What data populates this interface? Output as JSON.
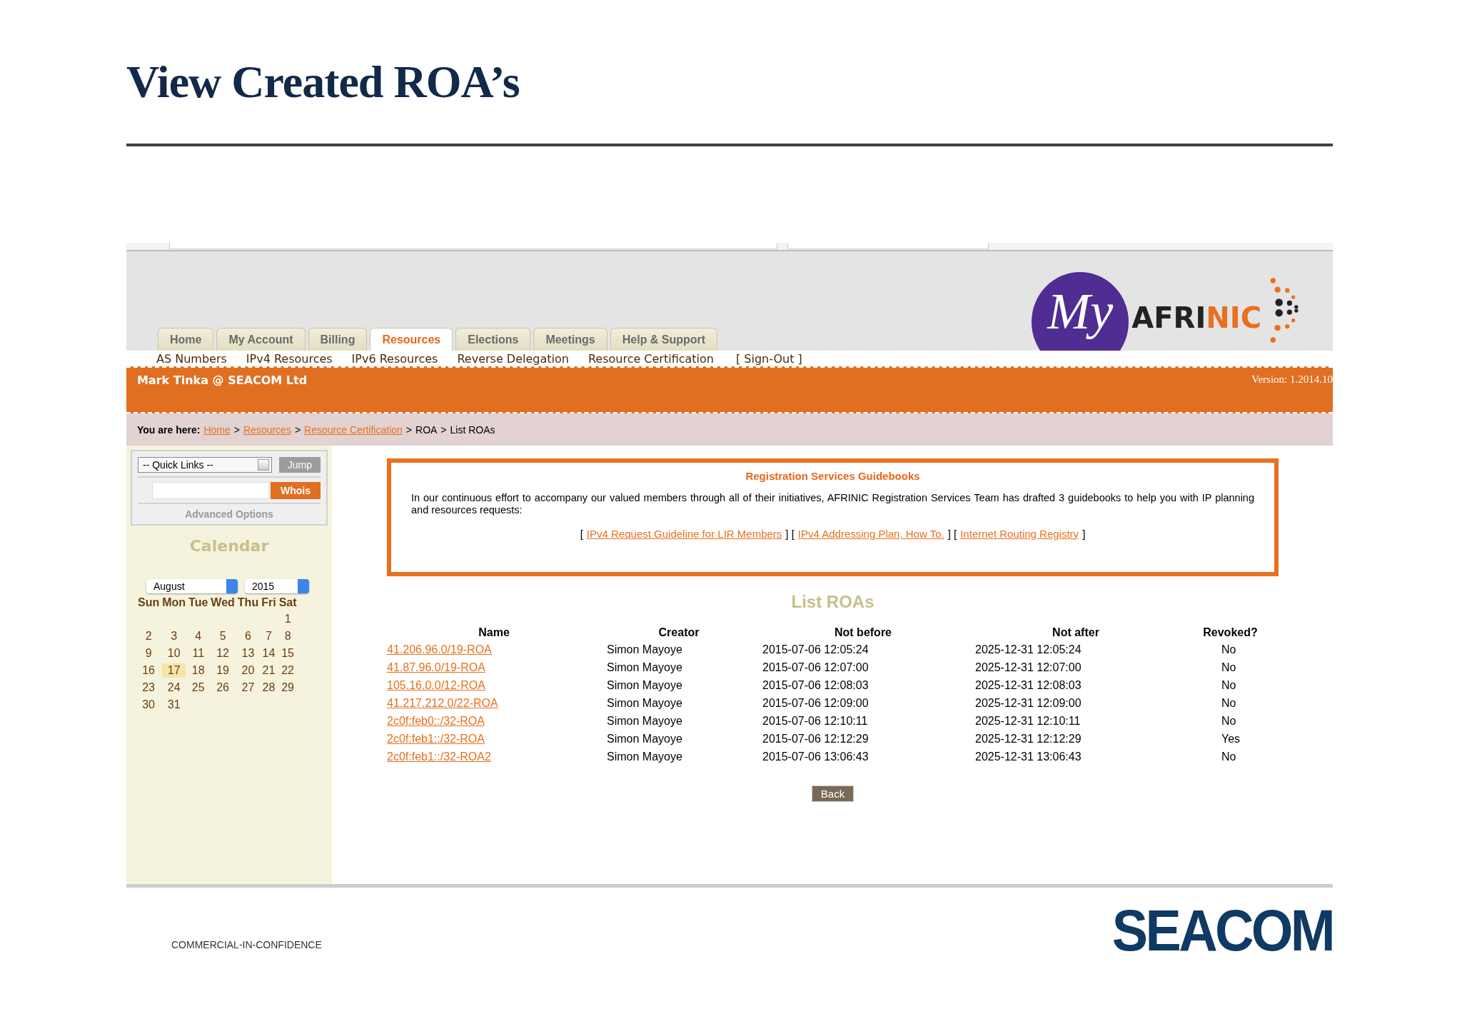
{
  "slide_title": "View Created ROA’s",
  "header": {
    "logo": {
      "script": "My",
      "wordmark_parts": [
        "AFRI",
        "NIC"
      ]
    }
  },
  "tabs": [
    {
      "label": "Home",
      "selected": false
    },
    {
      "label": "My Account",
      "selected": false
    },
    {
      "label": "Billing",
      "selected": false
    },
    {
      "label": "Resources",
      "selected": true
    },
    {
      "label": "Elections",
      "selected": false
    },
    {
      "label": "Meetings",
      "selected": false
    },
    {
      "label": "Help & Support",
      "selected": false
    }
  ],
  "submenu": [
    "AS Numbers",
    "IPv4 Resources",
    "IPv6 Resources",
    "Reverse Delegation",
    "Resource Certification",
    "[ Sign-Out ]"
  ],
  "user_bar": {
    "user": "Mark Tinka @ SEACOM Ltd",
    "version": "Version: 1.2014.10"
  },
  "breadcrumb": {
    "label": "You are here:",
    "items": [
      {
        "kind": "link",
        "text": "Home"
      },
      {
        "kind": "separator",
        "text": ">"
      },
      {
        "kind": "link",
        "text": "Resources"
      },
      {
        "kind": "separator",
        "text": ">"
      },
      {
        "kind": "link",
        "text": "Resource Certification"
      },
      {
        "kind": "separator",
        "text": ">"
      },
      {
        "kind": "text",
        "text": "ROA"
      },
      {
        "kind": "separator",
        "text": ">"
      },
      {
        "kind": "text",
        "text": "List ROAs"
      }
    ]
  },
  "sidebar": {
    "quick_links": {
      "value": "-- Quick Links --",
      "button": "Jump"
    },
    "whois": {
      "button": "Whois"
    },
    "advanced": "Advanced Options",
    "calendar": {
      "title": "Calendar",
      "month": "August",
      "year": "2015",
      "weekdays": [
        "Sun",
        "Mon",
        "Tue",
        "Wed",
        "Thu",
        "Fri",
        "Sat"
      ],
      "weeks": [
        {
          "kind": "partial",
          "days": [
            {
              "label": "1",
              "selected": false
            }
          ]
        },
        {
          "kind": "full",
          "days": [
            {
              "label": "2",
              "selected": false
            },
            {
              "label": "3",
              "selected": false
            },
            {
              "label": "4",
              "selected": false
            },
            {
              "label": "5",
              "selected": false
            },
            {
              "label": "6",
              "selected": false
            },
            {
              "label": "7",
              "selected": false
            },
            {
              "label": "8",
              "selected": false
            }
          ]
        },
        {
          "kind": "full",
          "days": [
            {
              "label": "9",
              "selected": false
            },
            {
              "label": "10",
              "selected": false
            },
            {
              "label": "11",
              "selected": false
            },
            {
              "label": "12",
              "selected": false
            },
            {
              "label": "13",
              "selected": false
            },
            {
              "label": "14",
              "selected": false
            },
            {
              "label": "15",
              "selected": false
            }
          ]
        },
        {
          "kind": "full",
          "days": [
            {
              "label": "16",
              "selected": false
            },
            {
              "label": "17",
              "selected": true
            },
            {
              "label": "18",
              "selected": false
            },
            {
              "label": "19",
              "selected": false
            },
            {
              "label": "20",
              "selected": false
            },
            {
              "label": "21",
              "selected": false
            },
            {
              "label": "22",
              "selected": false
            }
          ]
        },
        {
          "kind": "full",
          "days": [
            {
              "label": "23",
              "selected": false
            },
            {
              "label": "24",
              "selected": false
            },
            {
              "label": "25",
              "selected": false
            },
            {
              "label": "26",
              "selected": false
            },
            {
              "label": "27",
              "selected": false
            },
            {
              "label": "28",
              "selected": false
            },
            {
              "label": "29",
              "selected": false
            }
          ]
        },
        {
          "kind": "full",
          "days": [
            {
              "label": "30",
              "selected": false
            },
            {
              "label": "31",
              "selected": false
            }
          ]
        }
      ]
    }
  },
  "guidebooks": {
    "title": "Registration Services Guidebooks",
    "text": "In our continuous effort to accompany our valued members through all of their initiatives, AFRINIC Registration Services Team has drafted 3 guidebooks to help you with IP planning and resources requests:",
    "parts": [
      {
        "kind": "bracket",
        "text": "["
      },
      {
        "kind": "link",
        "text": "IPv4 Request Guideline for LIR Members"
      },
      {
        "kind": "bracket",
        "text": "] ["
      },
      {
        "kind": "link",
        "text": "IPv4 Addressing Plan, How To."
      },
      {
        "kind": "bracket",
        "text": "] ["
      },
      {
        "kind": "link",
        "text": "Internet Routing Registry"
      },
      {
        "kind": "bracket",
        "text": "]"
      }
    ]
  },
  "roa_list": {
    "title": "List ROAs",
    "columns": [
      "Name",
      "Creator",
      "Not before",
      "Not after",
      "Revoked?"
    ],
    "rows": [
      {
        "name": "41.206.96.0/19-ROA",
        "creator": "Simon Mayoye",
        "not_before": "2015-07-06 12:05:24",
        "not_after": "2025-12-31 12:05:24",
        "revoked": "No"
      },
      {
        "name": "41.87.96.0/19-ROA",
        "creator": "Simon Mayoye",
        "not_before": "2015-07-06 12:07:00",
        "not_after": "2025-12-31 12:07:00",
        "revoked": "No"
      },
      {
        "name": "105.16.0.0/12-ROA",
        "creator": "Simon Mayoye",
        "not_before": "2015-07-06 12:08:03",
        "not_after": "2025-12-31 12:08:03",
        "revoked": "No"
      },
      {
        "name": "41.217.212.0/22-ROA",
        "creator": "Simon Mayoye",
        "not_before": "2015-07-06 12:09:00",
        "not_after": "2025-12-31 12:09:00",
        "revoked": "No"
      },
      {
        "name": "2c0f:feb0::/32-ROA",
        "creator": "Simon Mayoye",
        "not_before": "2015-07-06 12:10:11",
        "not_after": "2025-12-31 12:10:11",
        "revoked": "No"
      },
      {
        "name": "2c0f:feb1::/32-ROA",
        "creator": "Simon Mayoye",
        "not_before": "2015-07-06 12:12:29",
        "not_after": "2025-12-31 12:12:29",
        "revoked": "Yes"
      },
      {
        "name": "2c0f:feb1::/32-ROA2",
        "creator": "Simon Mayoye",
        "not_before": "2015-07-06 13:06:43",
        "not_after": "2025-12-31 13:06:43",
        "revoked": "No"
      }
    ],
    "button": "Back"
  },
  "slide_footer": {
    "confidentiality": "COMMERCIAL-IN-CONFIDENCE",
    "logo": "SEACOM"
  }
}
